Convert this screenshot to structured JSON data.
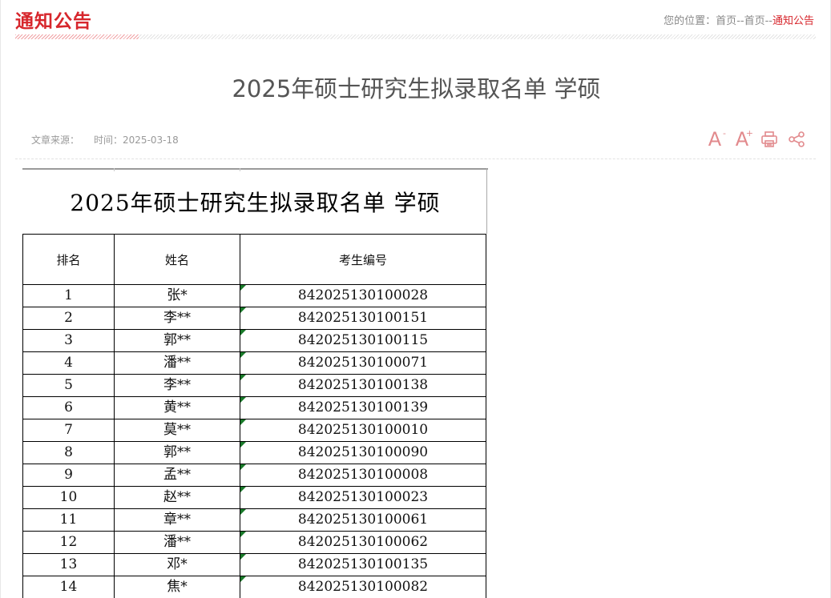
{
  "header": {
    "title": "通知公告",
    "breadcrumb_label": "您的位置：",
    "breadcrumb": [
      "首页",
      "首页",
      "通知公告"
    ],
    "breadcrumb_sep": "--"
  },
  "article": {
    "title": "2025年硕士研究生拟录取名单 学硕",
    "source_label": "文章来源：",
    "time_label": "时间：",
    "time_value": "2025-03-18",
    "tools": [
      {
        "name": "font-decrease-icon",
        "glyph": "A",
        "sup": "-"
      },
      {
        "name": "font-increase-icon",
        "glyph": "A",
        "sup": "+"
      },
      {
        "name": "print-icon"
      },
      {
        "name": "share-icon"
      }
    ]
  },
  "document": {
    "title": "2025年硕士研究生拟录取名单 学硕",
    "headers": [
      "排名",
      "姓名",
      "考生编号"
    ],
    "rows": [
      [
        "1",
        "张*",
        "842025130100028"
      ],
      [
        "2",
        "李**",
        "842025130100151"
      ],
      [
        "3",
        "郭**",
        "842025130100115"
      ],
      [
        "4",
        "潘**",
        "842025130100071"
      ],
      [
        "5",
        "李**",
        "842025130100138"
      ],
      [
        "6",
        "黄**",
        "842025130100139"
      ],
      [
        "7",
        "莫**",
        "842025130100010"
      ],
      [
        "8",
        "郭**",
        "842025130100090"
      ],
      [
        "9",
        "孟**",
        "842025130100008"
      ],
      [
        "10",
        "赵**",
        "842025130100023"
      ],
      [
        "11",
        "章**",
        "842025130100061"
      ],
      [
        "12",
        "潘**",
        "842025130100062"
      ],
      [
        "13",
        "邓*",
        "842025130100135"
      ],
      [
        "14",
        "焦*",
        "842025130100082"
      ]
    ]
  },
  "colors": {
    "accent": "#d7262c",
    "icon": "#e28a8d",
    "cell_flag": "#1a7a2a"
  }
}
